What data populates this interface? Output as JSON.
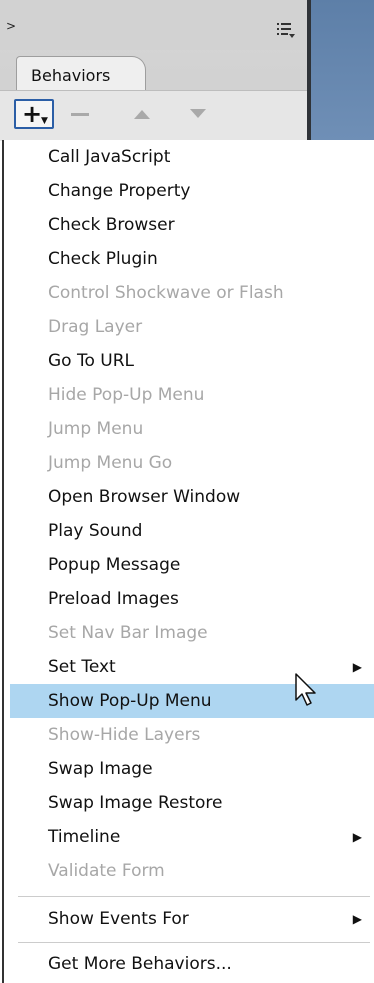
{
  "panel": {
    "tab_label": "Behaviors",
    "collapse_glyph": ">",
    "toolbar": {
      "add_glyph": "+",
      "add_caret": "▼"
    }
  },
  "menu": {
    "items": [
      {
        "label": "Call JavaScript",
        "enabled": true
      },
      {
        "label": "Change Property",
        "enabled": true
      },
      {
        "label": "Check Browser",
        "enabled": true
      },
      {
        "label": "Check Plugin",
        "enabled": true
      },
      {
        "label": "Control Shockwave or Flash",
        "enabled": false
      },
      {
        "label": "Drag Layer",
        "enabled": false
      },
      {
        "label": "Go To URL",
        "enabled": true
      },
      {
        "label": "Hide Pop-Up Menu",
        "enabled": false
      },
      {
        "label": "Jump Menu",
        "enabled": false
      },
      {
        "label": "Jump Menu Go",
        "enabled": false
      },
      {
        "label": "Open Browser Window",
        "enabled": true
      },
      {
        "label": "Play Sound",
        "enabled": true
      },
      {
        "label": "Popup Message",
        "enabled": true
      },
      {
        "label": "Preload Images",
        "enabled": true
      },
      {
        "label": "Set Nav Bar Image",
        "enabled": false
      },
      {
        "label": "Set Text",
        "enabled": true,
        "submenu": true
      },
      {
        "label": "Show Pop-Up Menu",
        "enabled": true,
        "highlighted": true
      },
      {
        "label": "Show-Hide Layers",
        "enabled": false
      },
      {
        "label": "Swap Image",
        "enabled": true
      },
      {
        "label": "Swap Image Restore",
        "enabled": true
      },
      {
        "label": "Timeline",
        "enabled": true,
        "submenu": true
      },
      {
        "label": "Validate Form",
        "enabled": false
      },
      {
        "label": "Show Events For",
        "enabled": true,
        "submenu": true
      },
      {
        "label": "Get More Behaviors...",
        "enabled": true
      }
    ],
    "submenu_glyph": "▶"
  },
  "colors": {
    "highlight": "#aed6f1",
    "disabled_text": "#a7a7a7",
    "accent_border": "#2b5ea6",
    "side_bar": "#6f8fb6"
  }
}
